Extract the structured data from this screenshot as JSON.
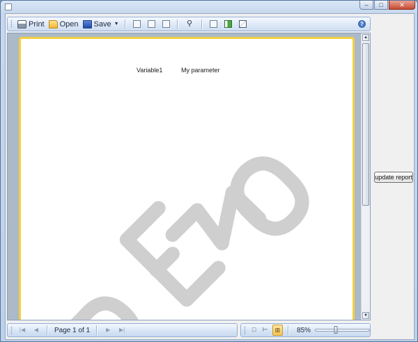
{
  "window": {
    "title": "",
    "controls": {
      "minimize": "–",
      "maximize": "□",
      "close": "✕"
    }
  },
  "toolbar": {
    "print_label": "Print",
    "open_label": "Open",
    "save_label": "Save"
  },
  "report": {
    "field_variable": "Variable1",
    "field_parameter": "My parameter",
    "watermark_text": "DEMO"
  },
  "navigation": {
    "page_status": "Page 1 of 1"
  },
  "zoom": {
    "level_label": "85%",
    "level_value": 85,
    "slider_fraction": 0.38
  },
  "actions": {
    "update_report_label": "update report"
  },
  "colors": {
    "page_border": "#f3cf3f",
    "watermark": "#cfcfcf",
    "active_view_button": "#f7c456"
  }
}
